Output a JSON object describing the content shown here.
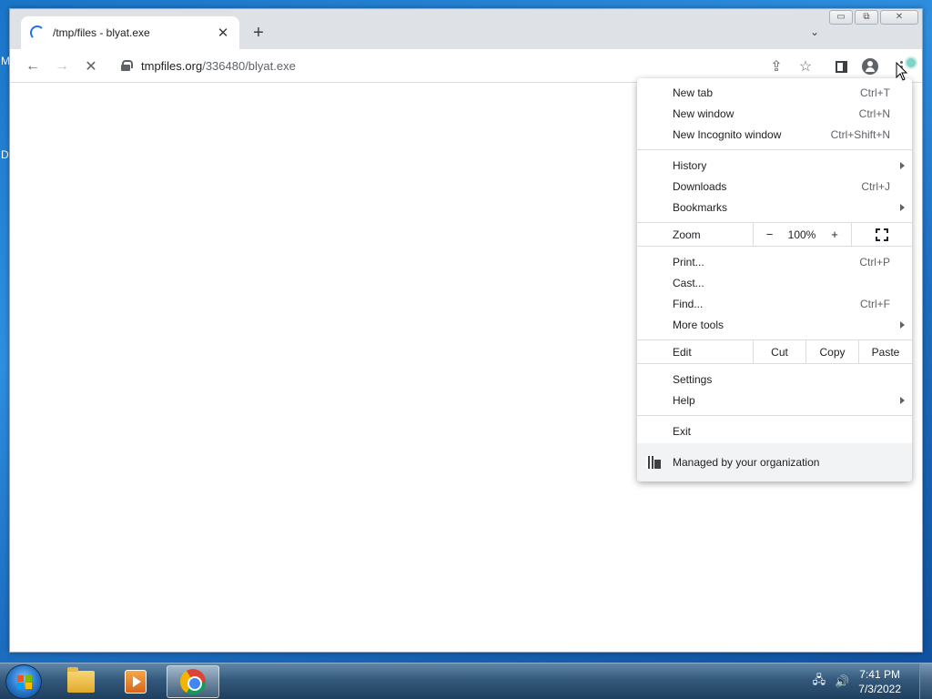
{
  "desktop": {
    "edge_text_1": "M",
    "edge_text_2": "D"
  },
  "window": {
    "controls": {
      "minimize": "▭",
      "maximize": "⧉",
      "close": "✕"
    }
  },
  "tab": {
    "title": "/tmp/files - blyat.exe",
    "close_label": "✕",
    "loading": true
  },
  "tabstrip": {
    "new_tab_label": "+",
    "tab_search_label": "⌄"
  },
  "toolbar": {
    "back_label": "←",
    "forward_label": "→",
    "stop_label": "✕",
    "url_host": "tmpfiles.org",
    "url_path": "/336480/blyat.exe",
    "share_label": "⇪",
    "bookmark_label": "☆"
  },
  "menu": {
    "items_group_1": [
      {
        "label": "New tab",
        "shortcut": "Ctrl+T"
      },
      {
        "label": "New window",
        "shortcut": "Ctrl+N"
      },
      {
        "label": "New Incognito window",
        "shortcut": "Ctrl+Shift+N"
      }
    ],
    "items_group_2": [
      {
        "label": "History",
        "shortcut": ""
      },
      {
        "label": "Downloads",
        "shortcut": "Ctrl+J"
      },
      {
        "label": "Bookmarks",
        "shortcut": ""
      }
    ],
    "zoom": {
      "label": "Zoom",
      "minus": "−",
      "value": "100%",
      "plus": "+"
    },
    "items_group_3": [
      {
        "label": "Print...",
        "shortcut": "Ctrl+P"
      },
      {
        "label": "Cast...",
        "shortcut": ""
      },
      {
        "label": "Find...",
        "shortcut": "Ctrl+F"
      },
      {
        "label": "More tools",
        "shortcut": ""
      }
    ],
    "edit": {
      "label": "Edit",
      "cut": "Cut",
      "copy": "Copy",
      "paste": "Paste"
    },
    "items_group_4": [
      {
        "label": "Settings",
        "shortcut": ""
      },
      {
        "label": "Help",
        "shortcut": ""
      }
    ],
    "exit_label": "Exit",
    "managed_label": "Managed by your organization"
  },
  "taskbar": {
    "clock_time": "7:41 PM",
    "clock_date": "7/3/2022",
    "network_icon": "🖧",
    "volume_icon": "🔊"
  }
}
